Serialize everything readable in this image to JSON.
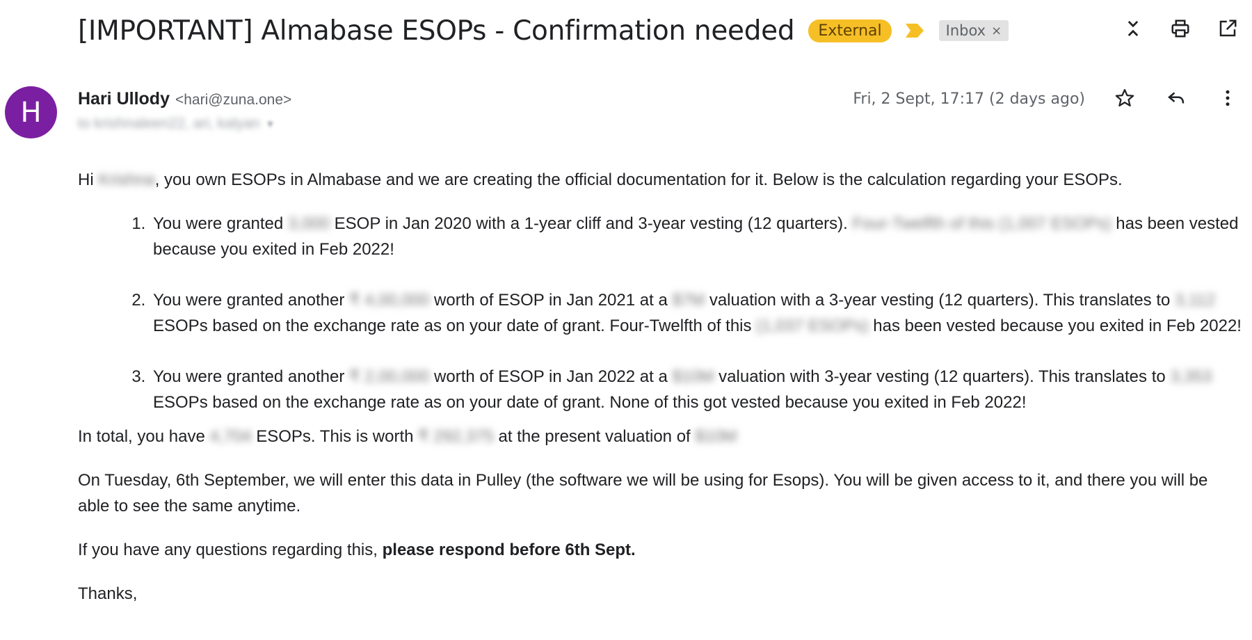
{
  "subject": {
    "title": "[IMPORTANT] Almabase ESOPs - Confirmation needed",
    "labels": {
      "external": "External",
      "inbox": "Inbox",
      "inbox_remove": "×"
    }
  },
  "toolbar": {
    "icons": [
      "collapse-icon",
      "print-icon",
      "open-new-window-icon"
    ]
  },
  "message": {
    "avatar_letter": "H",
    "sender_name": "Hari Ullody",
    "sender_email": "<hari@zuna.one>",
    "recipient_redacted": "to krishnaleen22, ari, kalyan",
    "recipient_caret": "▼",
    "date": "Fri, 2 Sept, 17:17 (2 days ago)",
    "action_icons": [
      "star-icon",
      "reply-icon",
      "more-vert-icon"
    ]
  },
  "body": {
    "greeting_pre": "Hi ",
    "greeting_name": "Krishna",
    "greeting_post": ", you own ESOPs in Almabase and we are creating the official documentation for it. Below is the calculation regarding your ESOPs.",
    "items": [
      {
        "t1": "You were granted ",
        "r1": "3,000",
        "t2": " ESOP in Jan 2020 with a 1-year cliff and 3-year vesting (12 quarters). ",
        "r2": "Four-Twelfth of this (1,007 ESOPs)",
        "t3": " has been vested because you exited in Feb 2022!"
      },
      {
        "t1": "You were granted another ",
        "r1": "₹ 4,00,000",
        "t2": " worth of ESOP in Jan 2021 at a ",
        "r2": "$7M",
        "t3": " valuation with a 3-year vesting (12 quarters). This translates to ",
        "r3": "3,112",
        "t4": " ESOPs based on the exchange rate as on your date of grant. Four-Twelfth of this ",
        "r4": "(1,037 ESOPs)",
        "t5": " has been vested because you exited in Feb 2022!"
      },
      {
        "t1": "You were granted another ",
        "r1": "₹ 2,00,000",
        "t2": " worth of ESOP in Jan 2022 at a ",
        "r2": "$10M",
        "t3": " valuation with 3-year vesting (12 quarters). This translates to ",
        "r3": "3,353",
        "t4": " ESOPs based on the exchange rate as on your date of grant. None of this got vested because you exited in Feb 2022!"
      }
    ],
    "total_t1": "In total, you have ",
    "total_r1": "4,704",
    "total_t2": " ESOPs. This is worth ",
    "total_r2": "₹ 292,375",
    "total_t3": " at the present valuation of ",
    "total_r3": "$10M",
    "pulley": "On Tuesday, 6th September, we will enter this data in Pulley (the software we will be using for Esops). You will be given access to it, and there you will be able to see the same anytime.",
    "questions_pre": "If you have any questions regarding this, ",
    "questions_bold": "please respond before 6th Sept.",
    "closing": "Thanks,"
  }
}
